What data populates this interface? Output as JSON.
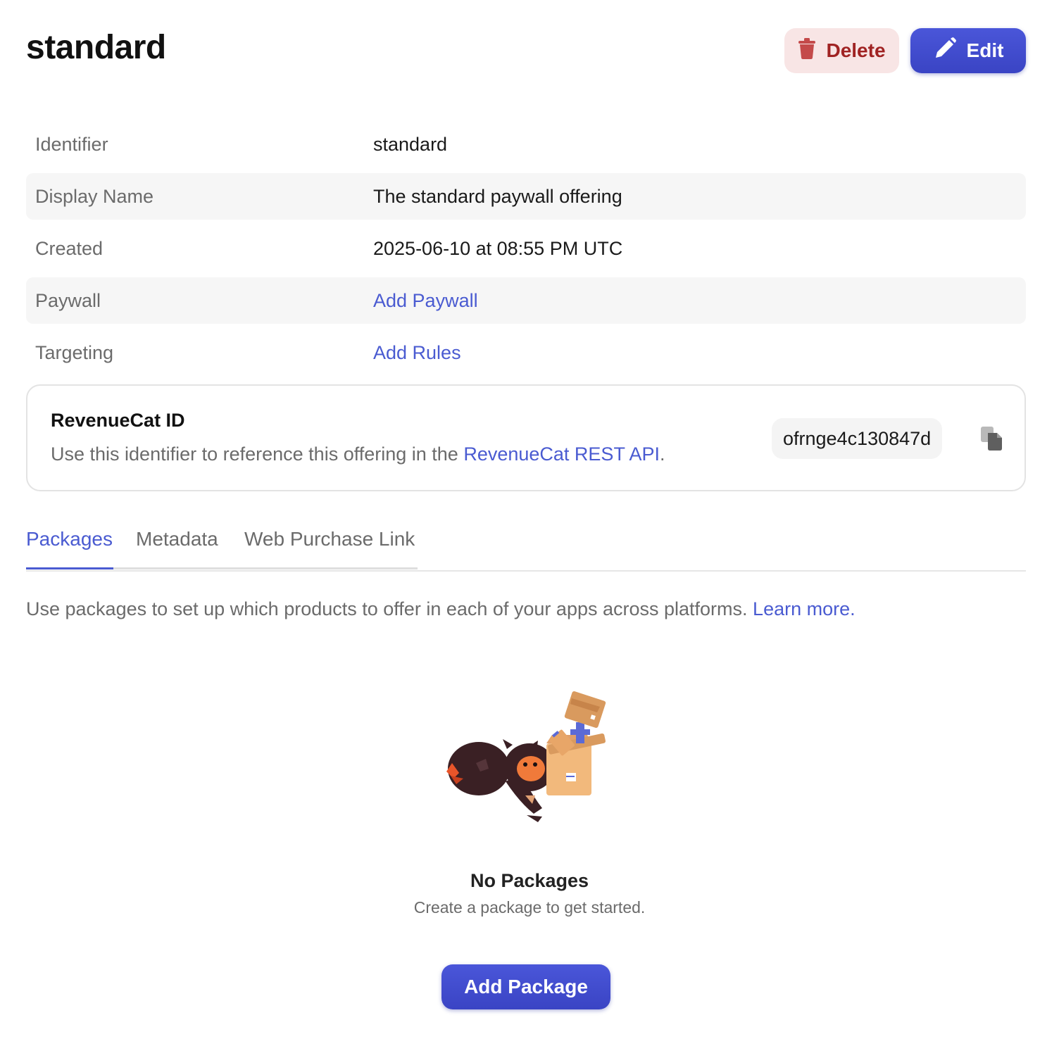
{
  "header": {
    "title": "standard",
    "delete_label": "Delete",
    "edit_label": "Edit"
  },
  "details": [
    {
      "label": "Identifier",
      "value": "standard",
      "is_link": false
    },
    {
      "label": "Display Name",
      "value": "The standard paywall offering",
      "is_link": false
    },
    {
      "label": "Created",
      "value": "2025-06-10 at 08:55 PM UTC",
      "is_link": false
    },
    {
      "label": "Paywall",
      "value": "Add Paywall",
      "is_link": true
    },
    {
      "label": "Targeting",
      "value": "Add Rules",
      "is_link": true
    }
  ],
  "id_card": {
    "title": "RevenueCat ID",
    "desc_prefix": "Use this identifier to reference this offering in the ",
    "desc_link": "RevenueCat REST API",
    "desc_suffix": ".",
    "id_value": "ofrnge4c130847d"
  },
  "tabs": [
    {
      "label": "Packages",
      "active": true
    },
    {
      "label": "Metadata",
      "active": false
    },
    {
      "label": "Web Purchase Link",
      "active": false
    }
  ],
  "packages": {
    "intro": "Use packages to set up which products to offer in each of your apps across platforms. ",
    "intro_link": "Learn more.",
    "empty_title": "No Packages",
    "empty_subtitle": "Create a package to get started.",
    "add_label": "Add Package"
  },
  "colors": {
    "accent": "#4a5bd1",
    "primary_button": "#3f4ad0",
    "delete_bg": "#f8e5e5",
    "delete_text": "#a02323"
  },
  "icons": {
    "delete": "trash-icon",
    "edit": "pencil-icon",
    "copy": "copy-icon"
  }
}
